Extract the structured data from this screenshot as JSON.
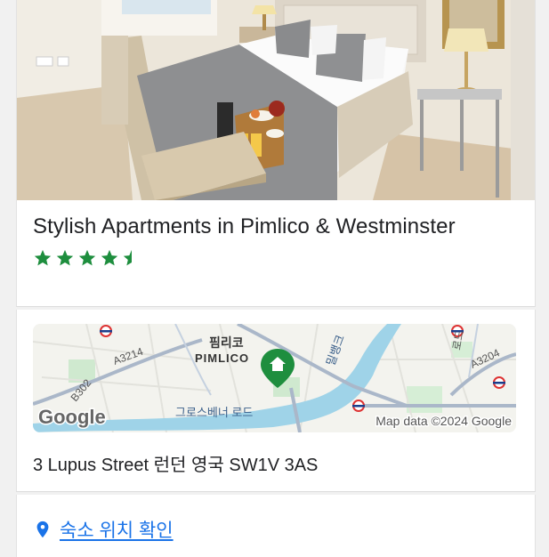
{
  "hotel": {
    "name": "Stylish Apartments in Pimlico & Westminster",
    "rating": 4.5,
    "rating_max": 5,
    "photo_icon": "hotel-room-photo"
  },
  "map": {
    "labels": {
      "pimlico_ko": "핌리코",
      "pimlico_en": "PIMLICO",
      "a3214": "A3214",
      "b302": "B302",
      "grosvenor_road": "그로스베너 로드",
      "millbank": "밀뱅크",
      "a3204": "A3204",
      "rd": "로드"
    },
    "logo": "Google",
    "attribution": "Map data ©2024 Google",
    "pin_icon": "home-pin-icon"
  },
  "address": "3 Lupus Street 런던 영국 SW1V 3AS",
  "location_link": {
    "icon": "location-pin-icon",
    "label": "숙소 위치 확인"
  },
  "colors": {
    "star": "#1e8e3e",
    "link": "#1a73e8",
    "pin": "#1e8e3e",
    "water": "#9fd3e8"
  }
}
